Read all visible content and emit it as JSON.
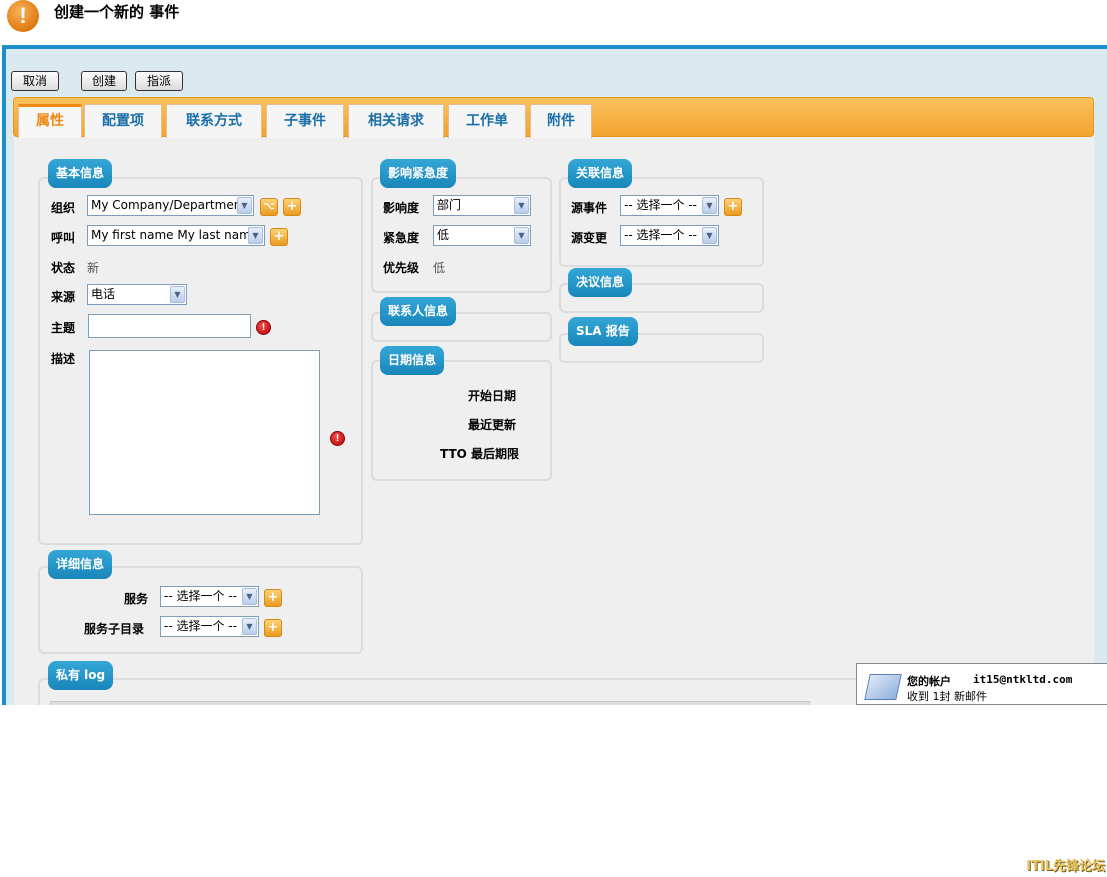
{
  "header": {
    "icon": "warning-icon",
    "title": "创建一个新的 事件"
  },
  "toolbar": {
    "cancel": "取消",
    "create": "创建",
    "assign": "指派"
  },
  "tabs": [
    {
      "label": "属性",
      "active": true
    },
    {
      "label": "配置项"
    },
    {
      "label": "联系方式"
    },
    {
      "label": "子事件"
    },
    {
      "label": "相关请求"
    },
    {
      "label": "工作单"
    },
    {
      "label": "附件"
    }
  ],
  "basic_info": {
    "title": "基本信息",
    "org_label": "组织",
    "org_value": "My Company/Department",
    "caller_label": "呼叫",
    "caller_value": "My first name My last name",
    "status_label": "状态",
    "status_value": "新",
    "source_label": "来源",
    "source_value": "电话",
    "subject_label": "主题",
    "subject_value": "",
    "desc_label": "描述",
    "desc_value": ""
  },
  "impact_urgency": {
    "title": "影响紧急度",
    "impact_label": "影响度",
    "impact_value": "部门",
    "urgency_label": "紧急度",
    "urgency_value": "低",
    "priority_label": "优先级",
    "priority_value": "低"
  },
  "related_info": {
    "title": "关联信息",
    "parent_incident_label": "源事件",
    "parent_incident_value": "-- 选择一个 --",
    "parent_change_label": "源变更",
    "parent_change_value": "-- 选择一个 --"
  },
  "resolution_info": {
    "title": "决议信息"
  },
  "sla_report": {
    "title": "SLA 报告"
  },
  "contact_info": {
    "title": "联系人信息"
  },
  "date_info": {
    "title": "日期信息",
    "start_date": "开始日期",
    "last_update": "最近更新",
    "tto_deadline": "TTO 最后期限"
  },
  "detail_info": {
    "title": "详细信息",
    "service_label": "服务",
    "service_value": "-- 选择一个 --",
    "subcategory_label": "服务子目录",
    "subcategory_value": "-- 选择一个 --"
  },
  "private_log": {
    "title": "私有 log"
  },
  "mail_popup": {
    "account_label": "您的帐户",
    "account_value": "it15@ntkltd.com",
    "received": "收到 1封 新邮件"
  },
  "watermark": "ITIL先锋论坛"
}
